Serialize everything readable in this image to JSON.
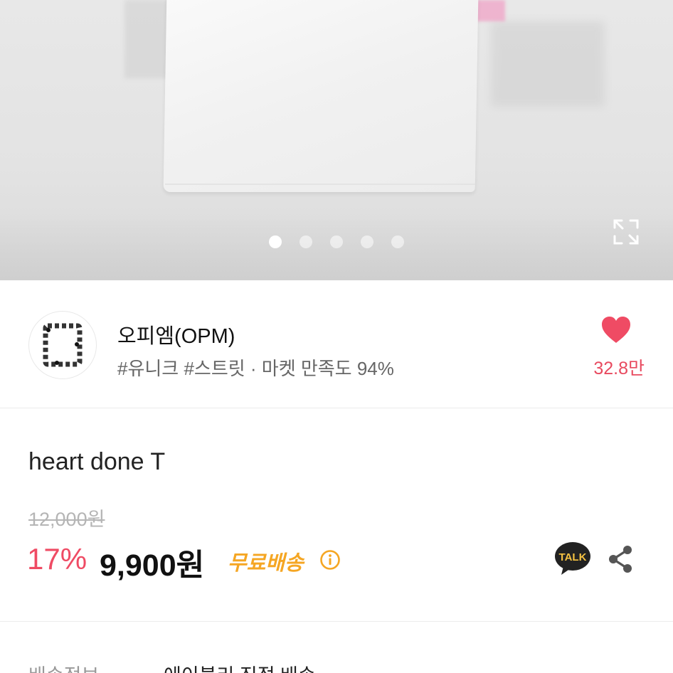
{
  "gallery": {
    "slide_count": 5,
    "active_index": 0
  },
  "shop": {
    "name": "오피엠(OPM)",
    "tags": "#유니크 #스트릿 · 마켓 만족도 94%",
    "like_count": "32.8만"
  },
  "product": {
    "title": "heart done T",
    "original_price": "12,000원",
    "discount": "17%",
    "price": "9,900원",
    "shipping_badge": "무료배송"
  },
  "shipping_info": {
    "label": "배송정보",
    "value": "에이블리 직접 배송"
  },
  "actions": {
    "talk_label": "TALK"
  },
  "colors": {
    "accent": "#ef4b64",
    "shipping": "#f5a623",
    "talk_bg": "#222222"
  }
}
